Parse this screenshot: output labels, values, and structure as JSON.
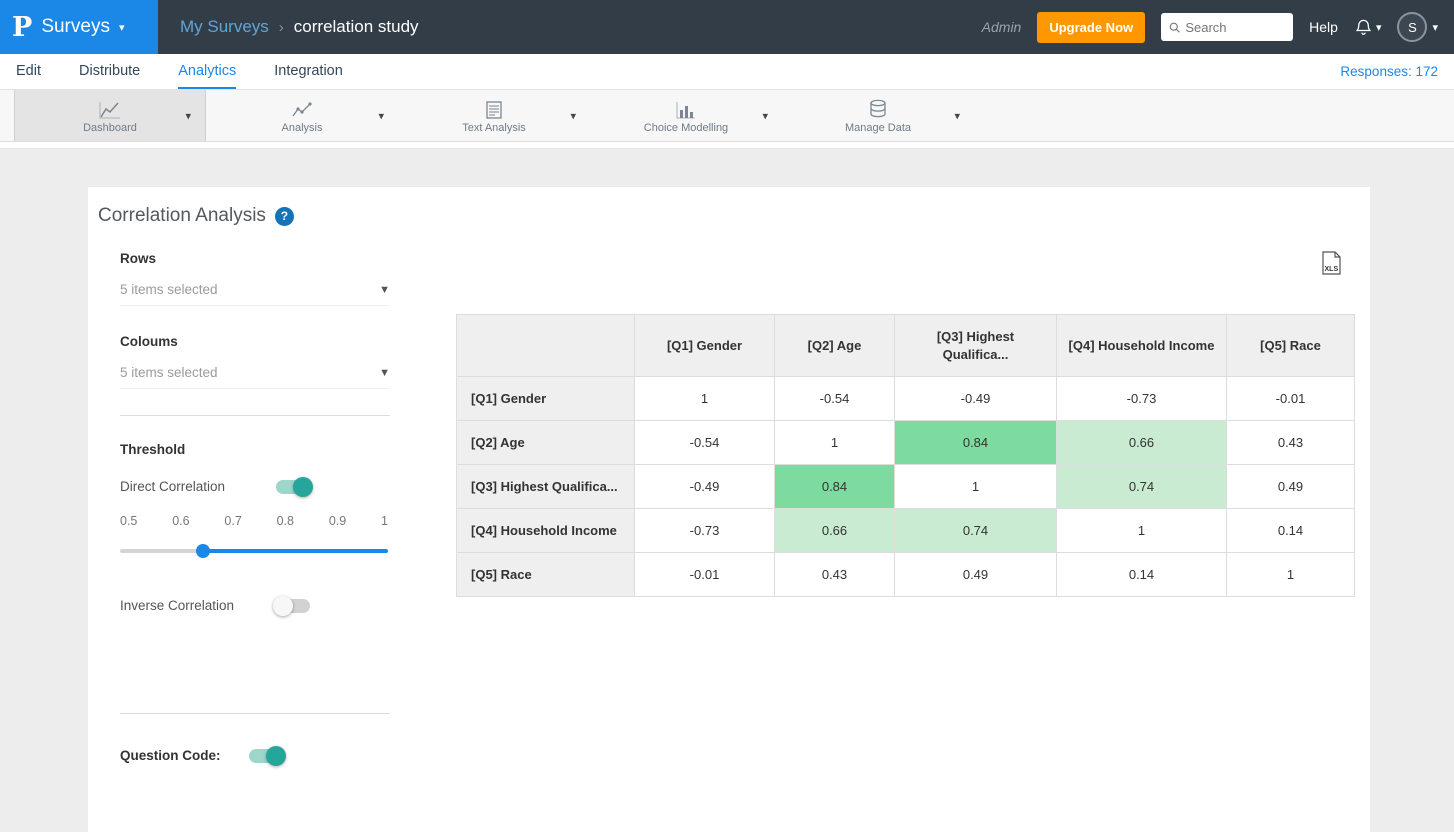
{
  "topbar": {
    "logo": "P",
    "app_menu_label": "Surveys",
    "breadcrumb": {
      "parent": "My Surveys",
      "separator": "›",
      "current": "correlation study"
    },
    "admin_label": "Admin",
    "upgrade_label": "Upgrade Now",
    "search_placeholder": "Search",
    "help_label": "Help",
    "avatar_initial": "S"
  },
  "nav": {
    "items": [
      "Edit",
      "Distribute",
      "Analytics",
      "Integration"
    ],
    "active": "Analytics",
    "responses_label": "Responses: 172"
  },
  "ribbon": {
    "items": [
      {
        "label": "Dashboard",
        "selected": true
      },
      {
        "label": "Analysis",
        "selected": false
      },
      {
        "label": "Text Analysis",
        "selected": false
      },
      {
        "label": "Choice Modelling",
        "selected": false
      },
      {
        "label": "Manage Data",
        "selected": false
      }
    ]
  },
  "panel": {
    "title": "Correlation Analysis",
    "rows_label": "Rows",
    "rows_value": "5 items selected",
    "columns_label": "Coloums",
    "columns_value": "5 items selected",
    "threshold_label": "Threshold",
    "direct_label": "Direct Correlation",
    "direct_on": true,
    "scale_labels": [
      "0.5",
      "0.6",
      "0.7",
      "0.8",
      "0.9",
      "1"
    ],
    "slider_value": 0.65,
    "inverse_label": "Inverse Correlation",
    "inverse_on": false,
    "question_code_label": "Question Code:",
    "question_code_on": true
  },
  "export": {
    "xls_label": "XLS"
  },
  "colors": {
    "accent_blue": "#1b87e6",
    "topbar_dark": "#333d47",
    "upgrade_orange": "#ff9800",
    "toggle_teal": "#26a69a"
  },
  "chart_data": {
    "type": "heatmap",
    "title": "Correlation Analysis",
    "columns": [
      "[Q1] Gender",
      "[Q2] Age",
      "[Q3] Highest Qualifica...",
      "[Q4] Household Income",
      "[Q5] Race"
    ],
    "rows": [
      "[Q1] Gender",
      "[Q2] Age",
      "[Q3] Highest Qualifica...",
      "[Q4] Household Income",
      "[Q5] Race"
    ],
    "values": [
      [
        1,
        -0.54,
        -0.49,
        -0.73,
        -0.01
      ],
      [
        -0.54,
        1,
        0.84,
        0.66,
        0.43
      ],
      [
        -0.49,
        0.84,
        1,
        0.74,
        0.49
      ],
      [
        -0.73,
        0.66,
        0.74,
        1,
        0.14
      ],
      [
        -0.01,
        0.43,
        0.49,
        0.14,
        1
      ]
    ],
    "highlight_rules": {
      "strong_min": 0.8,
      "strong_color": "#7edb9f",
      "moderate_min": 0.6,
      "moderate_color": "#c8ebd2",
      "exclude_diagonal": true
    }
  }
}
